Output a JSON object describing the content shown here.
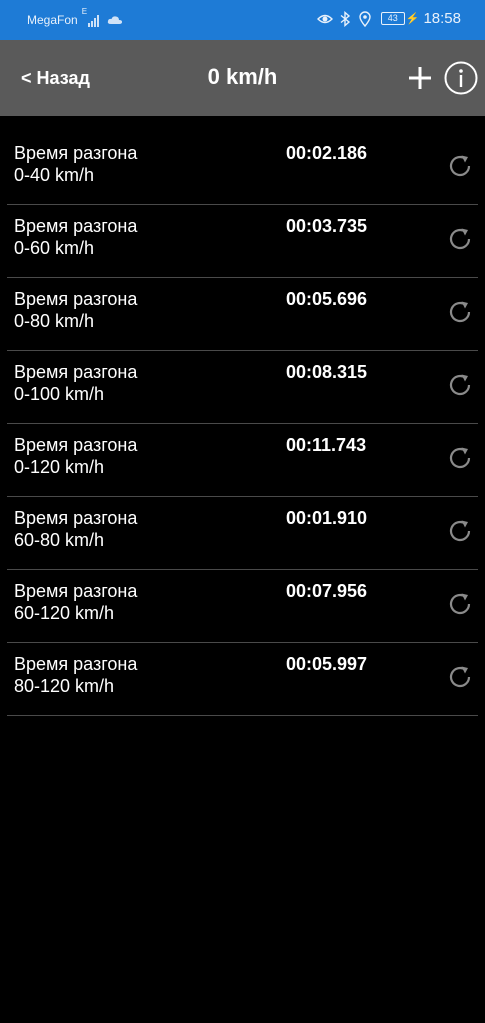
{
  "status_bar": {
    "carrier": "MegaFon",
    "network_type": "E",
    "battery": "43",
    "time": "18:58",
    "icons": [
      "signal-icon",
      "cloud-icon",
      "eye-icon",
      "bluetooth-icon",
      "location-icon",
      "battery-icon",
      "charging-icon"
    ]
  },
  "header": {
    "back_label": "< Назад",
    "title": "0 km/h",
    "add_icon": "plus-icon",
    "info_icon": "info-icon"
  },
  "rows": [
    {
      "line1": "Время разгона",
      "line2": "0-40 km/h",
      "time": "00:02.186"
    },
    {
      "line1": "Время разгона",
      "line2": "0-60 km/h",
      "time": "00:03.735"
    },
    {
      "line1": "Время разгона",
      "line2": "0-80 km/h",
      "time": "00:05.696"
    },
    {
      "line1": "Время разгона",
      "line2": "0-100 km/h",
      "time": "00:08.315"
    },
    {
      "line1": "Время разгона",
      "line2": "0-120 km/h",
      "time": "00:11.743"
    },
    {
      "line1": "Время разгона",
      "line2": "60-80 km/h",
      "time": "00:01.910"
    },
    {
      "line1": "Время разгона",
      "line2": "60-120 km/h",
      "time": "00:07.956"
    },
    {
      "line1": "Время разгона",
      "line2": "80-120 km/h",
      "time": "00:05.997"
    }
  ],
  "colors": {
    "status_bar_bg": "#1e7bd6",
    "header_bg": "#5a5a5a",
    "background": "#000000",
    "divider": "#4a4a4a",
    "reset_icon": "#8a8a8a"
  }
}
